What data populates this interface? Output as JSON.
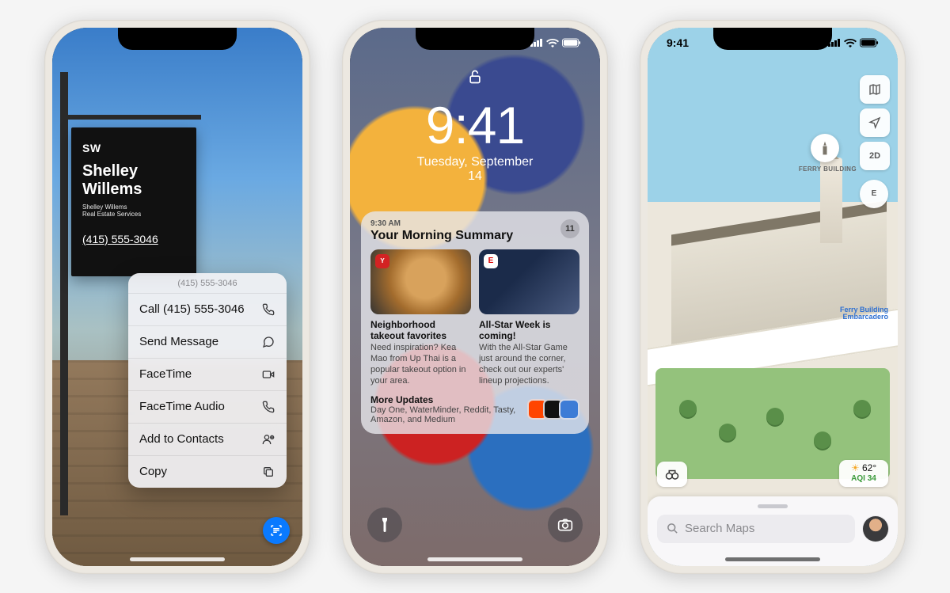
{
  "status_time": "9:41",
  "phone1": {
    "sign": {
      "sw": "SW",
      "name": "Shelley Willems",
      "subtitle": "Shelley Willems\nReal Estate Services",
      "phone": "(415) 555-3046"
    },
    "menu_header": "(415) 555-3046",
    "actions": [
      {
        "label": "Call (415) 555-3046",
        "icon": "phone"
      },
      {
        "label": "Send Message",
        "icon": "message"
      },
      {
        "label": "FaceTime",
        "icon": "video"
      },
      {
        "label": "FaceTime Audio",
        "icon": "phone"
      },
      {
        "label": "Add to Contacts",
        "icon": "contact"
      },
      {
        "label": "Copy",
        "icon": "copy"
      }
    ]
  },
  "phone2": {
    "time": "9:41",
    "date": "Tuesday, September 14",
    "summary_time": "9:30 AM",
    "summary_title": "Your Morning Summary",
    "summary_count": "11",
    "cards": [
      {
        "headline": "Neighborhood takeout favorites",
        "body": "Need inspiration? Kea Mao from Up Thai is a popular takeout option in your area."
      },
      {
        "headline": "All-Star Week is coming!",
        "body": "With the All-Star Game just around the corner, check out our experts' lineup projections."
      }
    ],
    "more_title": "More Updates",
    "more_body": "Day One, WaterMinder, Reddit, Tasty, Amazon, and Medium"
  },
  "phone3": {
    "controls": {
      "twod": "2D",
      "compass": "E"
    },
    "pin_label": "FERRY BUILDING",
    "transit_label": "Ferry Building\nEmbarcadero",
    "weather": {
      "temp": "62°",
      "aqi": "AQI 34"
    },
    "search_placeholder": "Search Maps"
  }
}
